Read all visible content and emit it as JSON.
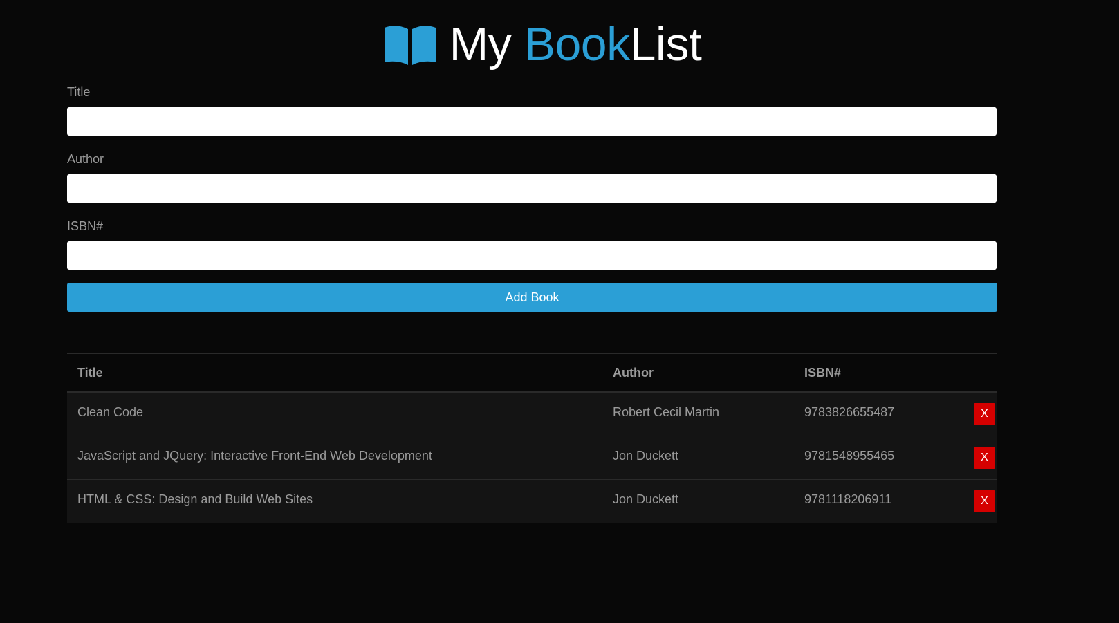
{
  "header": {
    "title_part1": "My ",
    "title_part2": "Book",
    "title_part3": "List",
    "icon": "book-open-icon",
    "accent_color": "#2b9fd6"
  },
  "form": {
    "title_label": "Title",
    "title_value": "",
    "author_label": "Author",
    "author_value": "",
    "isbn_label": "ISBN#",
    "isbn_value": "",
    "submit_label": "Add Book"
  },
  "table": {
    "headers": [
      "Title",
      "Author",
      "ISBN#"
    ],
    "rows": [
      {
        "title": "Clean Code",
        "author": "Robert Cecil Martin",
        "isbn": "9783826655487",
        "delete_label": "X"
      },
      {
        "title": "JavaScript and JQuery: Interactive Front-End Web Development",
        "author": "Jon Duckett",
        "isbn": "9781548955465",
        "delete_label": "X"
      },
      {
        "title": "HTML & CSS: Design and Build Web Sites",
        "author": "Jon Duckett",
        "isbn": "9781118206911",
        "delete_label": "X"
      }
    ]
  },
  "colors": {
    "background": "#080808",
    "accent": "#2b9fd6",
    "danger": "#d50000"
  }
}
